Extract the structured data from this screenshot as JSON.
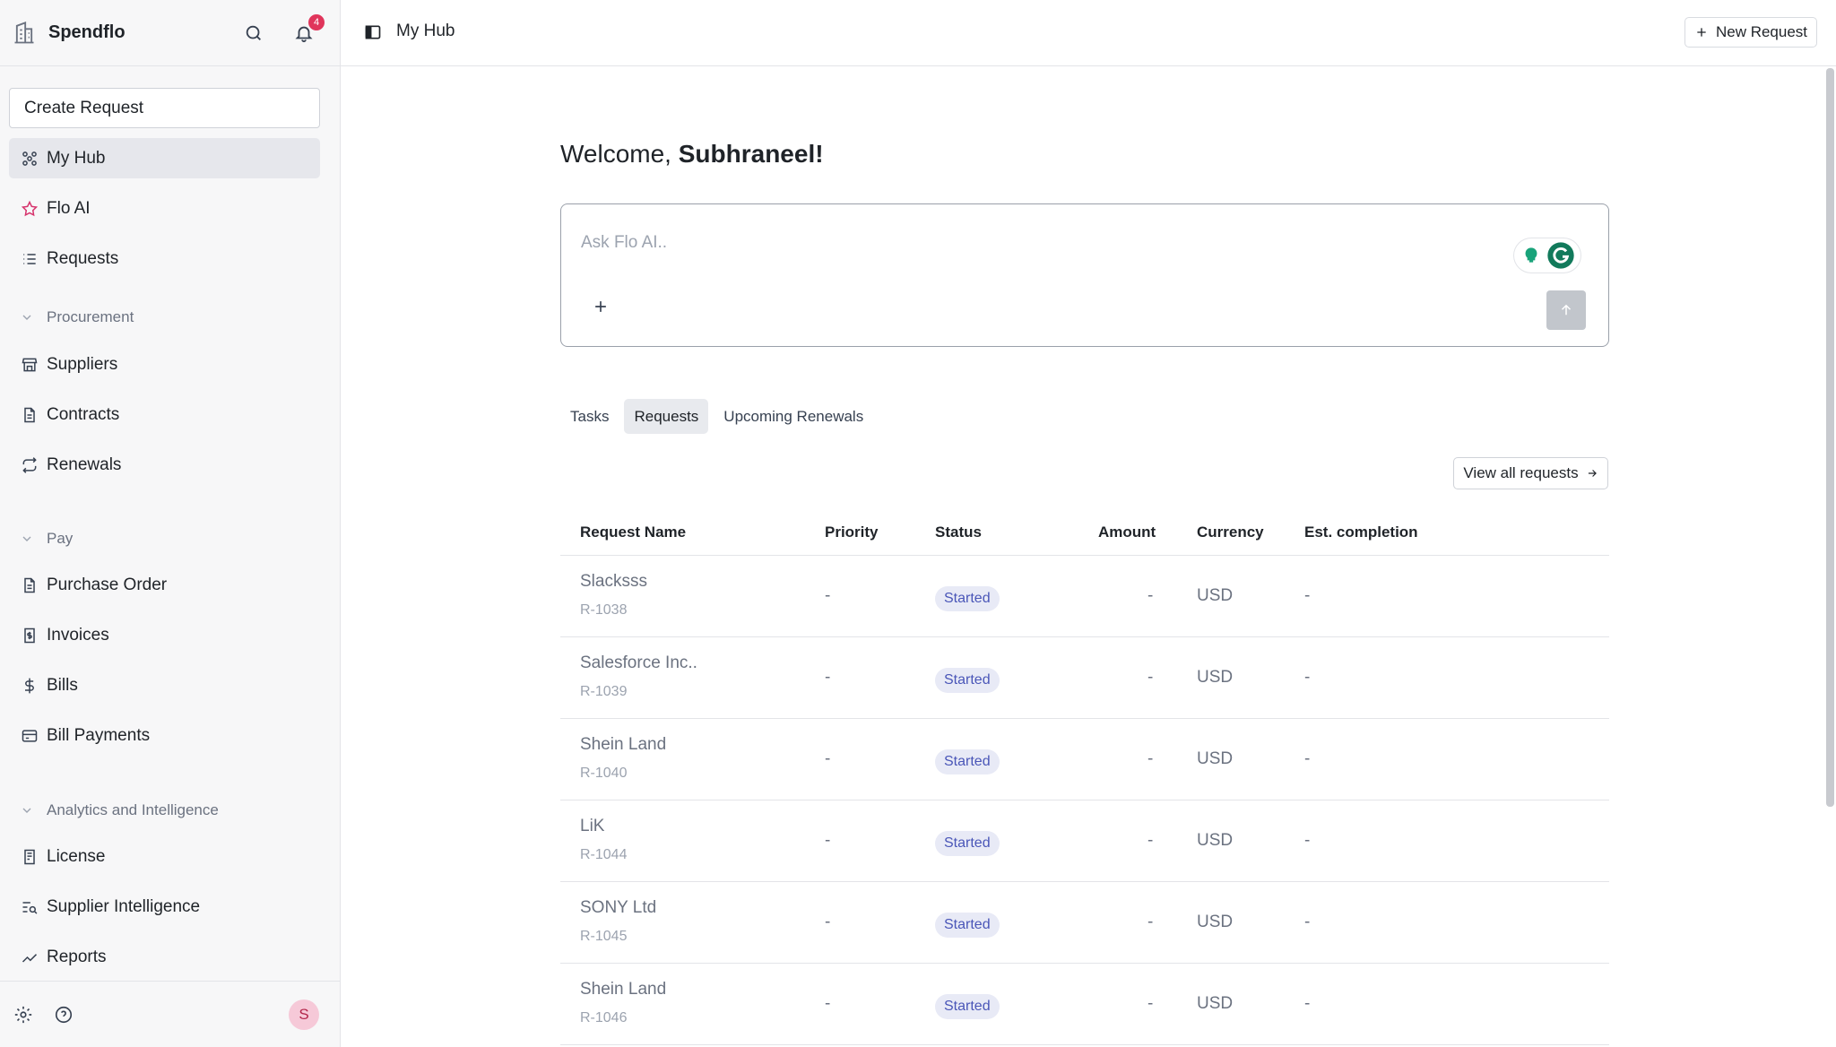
{
  "app": {
    "brand": "Spendflo",
    "notification_count": "4"
  },
  "sidebar": {
    "create_label": "Create Request",
    "top_items": [
      {
        "label": "My Hub",
        "icon": "hub-icon"
      },
      {
        "label": "Flo AI",
        "icon": "star-icon"
      },
      {
        "label": "Requests",
        "icon": "list-icon"
      }
    ],
    "sections": [
      {
        "title": "Procurement",
        "items": [
          {
            "label": "Suppliers"
          },
          {
            "label": "Contracts"
          },
          {
            "label": "Renewals"
          }
        ]
      },
      {
        "title": "Pay",
        "items": [
          {
            "label": "Purchase Order"
          },
          {
            "label": "Invoices"
          },
          {
            "label": "Bills"
          },
          {
            "label": "Bill Payments"
          }
        ]
      },
      {
        "title": "Analytics and Intelligence",
        "items": [
          {
            "label": "License"
          },
          {
            "label": "Supplier Intelligence"
          },
          {
            "label": "Reports"
          }
        ]
      }
    ],
    "avatar_initial": "S"
  },
  "topbar": {
    "breadcrumb": "My Hub",
    "new_request_label": "New Request"
  },
  "main": {
    "welcome_prefix": "Welcome, ",
    "welcome_name": "Subhraneel!",
    "ask": {
      "placeholder": "Ask Flo AI.."
    },
    "tabs": [
      {
        "label": "Tasks"
      },
      {
        "label": "Requests"
      },
      {
        "label": "Upcoming Renewals"
      }
    ],
    "view_all_label": "View all requests",
    "table": {
      "headers": {
        "name": "Request Name",
        "priority": "Priority",
        "status": "Status",
        "amount": "Amount",
        "currency": "Currency",
        "completion": "Est. completion"
      },
      "rows": [
        {
          "name": "Slacksss",
          "id": "R-1038",
          "priority": "-",
          "status": "Started",
          "amount": "-",
          "currency": "USD",
          "completion": "-"
        },
        {
          "name": "Salesforce Inc..",
          "id": "R-1039",
          "priority": "-",
          "status": "Started",
          "amount": "-",
          "currency": "USD",
          "completion": "-"
        },
        {
          "name": "Shein Land",
          "id": "R-1040",
          "priority": "-",
          "status": "Started",
          "amount": "-",
          "currency": "USD",
          "completion": "-"
        },
        {
          "name": "LiK",
          "id": "R-1044",
          "priority": "-",
          "status": "Started",
          "amount": "-",
          "currency": "USD",
          "completion": "-"
        },
        {
          "name": "SONY Ltd",
          "id": "R-1045",
          "priority": "-",
          "status": "Started",
          "amount": "-",
          "currency": "USD",
          "completion": "-"
        },
        {
          "name": "Shein Land",
          "id": "R-1046",
          "priority": "-",
          "status": "Started",
          "amount": "-",
          "currency": "USD",
          "completion": "-"
        }
      ]
    }
  }
}
